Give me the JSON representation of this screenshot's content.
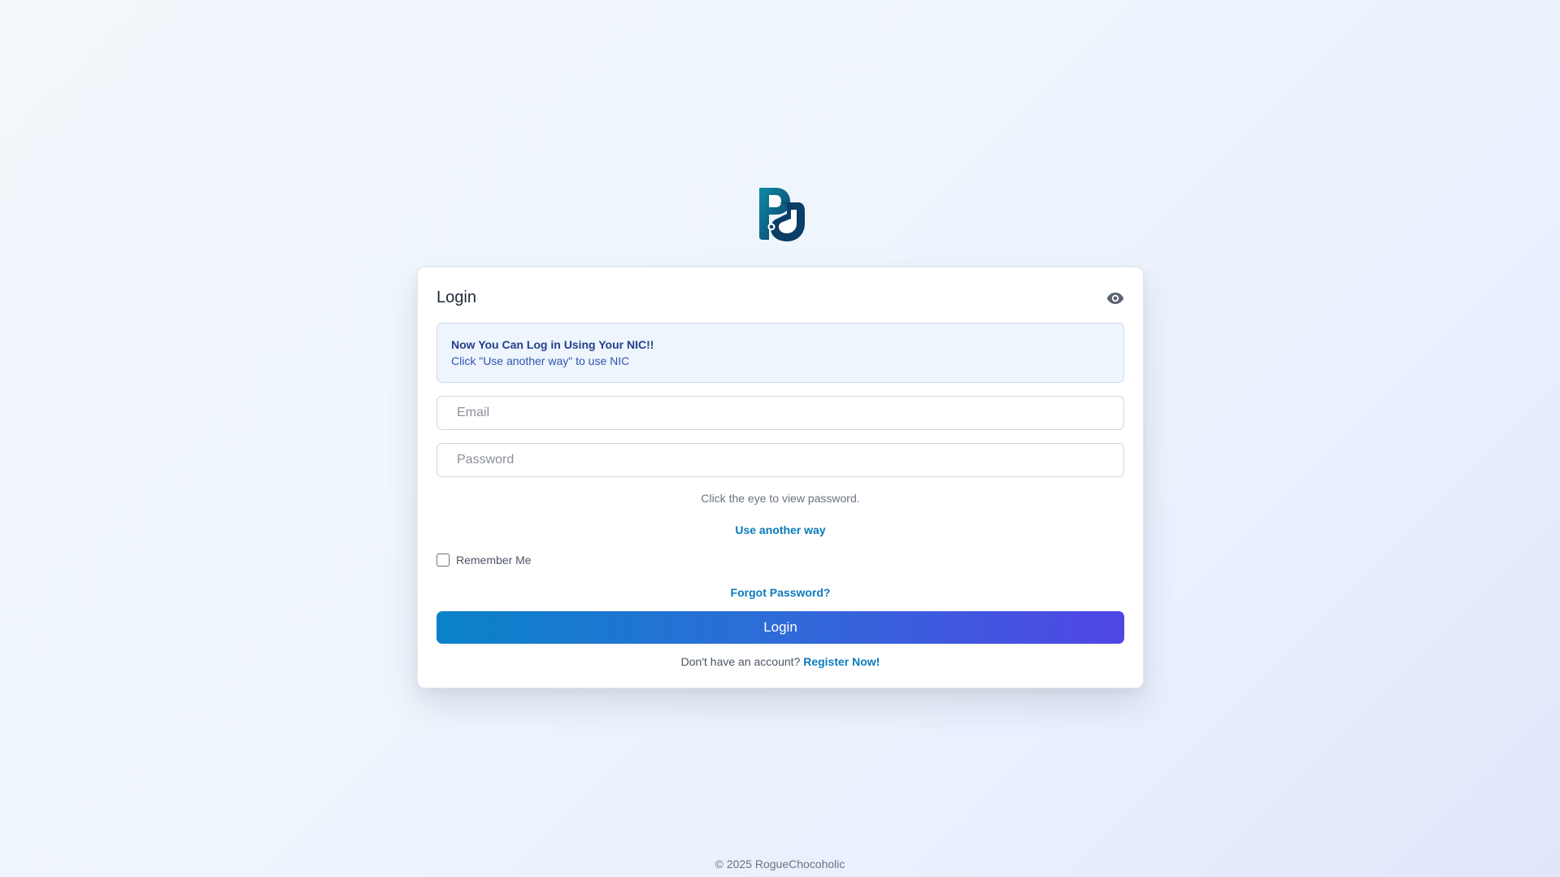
{
  "brand": {
    "logo_icon": "pd-monogram-icon",
    "logo_colors": [
      "#0f8aa6",
      "#0a3e66"
    ]
  },
  "login_card": {
    "title": "Login",
    "toggle_icon": "eye-icon",
    "notice": {
      "title": "Now You Can Log in Using Your NIC!!",
      "text": "Click \"Use another way\" to use NIC"
    },
    "email": {
      "placeholder": "Email",
      "value": ""
    },
    "password": {
      "placeholder": "Password",
      "value": ""
    },
    "eye_hint": "Click the eye to view password.",
    "use_another_way": "Use another way",
    "remember_me": {
      "label": "Remember Me",
      "checked": false
    },
    "forgot_password": "Forgot Password?",
    "login_button": "Login",
    "register_prompt": "Don't have an account?",
    "register_link": "Register Now!"
  },
  "footer": {
    "copyright": "© 2025 RogueChocoholic"
  },
  "colors": {
    "accent": "#0b7bbd",
    "button_start": "#0982c8",
    "button_end": "#4f46e5",
    "notice_text": "#243f8c"
  }
}
